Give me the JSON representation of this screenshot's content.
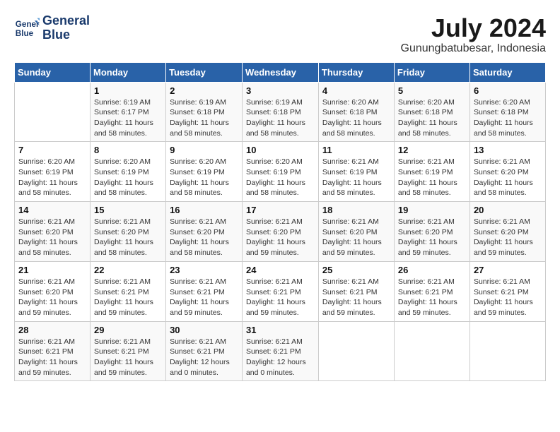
{
  "header": {
    "logo_line1": "General",
    "logo_line2": "Blue",
    "month_year": "July 2024",
    "location": "Gunungbatubesar, Indonesia"
  },
  "weekdays": [
    "Sunday",
    "Monday",
    "Tuesday",
    "Wednesday",
    "Thursday",
    "Friday",
    "Saturday"
  ],
  "weeks": [
    [
      {
        "num": "",
        "detail": ""
      },
      {
        "num": "1",
        "detail": "Sunrise: 6:19 AM\nSunset: 6:17 PM\nDaylight: 11 hours\nand 58 minutes."
      },
      {
        "num": "2",
        "detail": "Sunrise: 6:19 AM\nSunset: 6:18 PM\nDaylight: 11 hours\nand 58 minutes."
      },
      {
        "num": "3",
        "detail": "Sunrise: 6:19 AM\nSunset: 6:18 PM\nDaylight: 11 hours\nand 58 minutes."
      },
      {
        "num": "4",
        "detail": "Sunrise: 6:20 AM\nSunset: 6:18 PM\nDaylight: 11 hours\nand 58 minutes."
      },
      {
        "num": "5",
        "detail": "Sunrise: 6:20 AM\nSunset: 6:18 PM\nDaylight: 11 hours\nand 58 minutes."
      },
      {
        "num": "6",
        "detail": "Sunrise: 6:20 AM\nSunset: 6:18 PM\nDaylight: 11 hours\nand 58 minutes."
      }
    ],
    [
      {
        "num": "7",
        "detail": "Sunrise: 6:20 AM\nSunset: 6:19 PM\nDaylight: 11 hours\nand 58 minutes."
      },
      {
        "num": "8",
        "detail": "Sunrise: 6:20 AM\nSunset: 6:19 PM\nDaylight: 11 hours\nand 58 minutes."
      },
      {
        "num": "9",
        "detail": "Sunrise: 6:20 AM\nSunset: 6:19 PM\nDaylight: 11 hours\nand 58 minutes."
      },
      {
        "num": "10",
        "detail": "Sunrise: 6:20 AM\nSunset: 6:19 PM\nDaylight: 11 hours\nand 58 minutes."
      },
      {
        "num": "11",
        "detail": "Sunrise: 6:21 AM\nSunset: 6:19 PM\nDaylight: 11 hours\nand 58 minutes."
      },
      {
        "num": "12",
        "detail": "Sunrise: 6:21 AM\nSunset: 6:19 PM\nDaylight: 11 hours\nand 58 minutes."
      },
      {
        "num": "13",
        "detail": "Sunrise: 6:21 AM\nSunset: 6:20 PM\nDaylight: 11 hours\nand 58 minutes."
      }
    ],
    [
      {
        "num": "14",
        "detail": "Sunrise: 6:21 AM\nSunset: 6:20 PM\nDaylight: 11 hours\nand 58 minutes."
      },
      {
        "num": "15",
        "detail": "Sunrise: 6:21 AM\nSunset: 6:20 PM\nDaylight: 11 hours\nand 58 minutes."
      },
      {
        "num": "16",
        "detail": "Sunrise: 6:21 AM\nSunset: 6:20 PM\nDaylight: 11 hours\nand 58 minutes."
      },
      {
        "num": "17",
        "detail": "Sunrise: 6:21 AM\nSunset: 6:20 PM\nDaylight: 11 hours\nand 59 minutes."
      },
      {
        "num": "18",
        "detail": "Sunrise: 6:21 AM\nSunset: 6:20 PM\nDaylight: 11 hours\nand 59 minutes."
      },
      {
        "num": "19",
        "detail": "Sunrise: 6:21 AM\nSunset: 6:20 PM\nDaylight: 11 hours\nand 59 minutes."
      },
      {
        "num": "20",
        "detail": "Sunrise: 6:21 AM\nSunset: 6:20 PM\nDaylight: 11 hours\nand 59 minutes."
      }
    ],
    [
      {
        "num": "21",
        "detail": "Sunrise: 6:21 AM\nSunset: 6:20 PM\nDaylight: 11 hours\nand 59 minutes."
      },
      {
        "num": "22",
        "detail": "Sunrise: 6:21 AM\nSunset: 6:21 PM\nDaylight: 11 hours\nand 59 minutes."
      },
      {
        "num": "23",
        "detail": "Sunrise: 6:21 AM\nSunset: 6:21 PM\nDaylight: 11 hours\nand 59 minutes."
      },
      {
        "num": "24",
        "detail": "Sunrise: 6:21 AM\nSunset: 6:21 PM\nDaylight: 11 hours\nand 59 minutes."
      },
      {
        "num": "25",
        "detail": "Sunrise: 6:21 AM\nSunset: 6:21 PM\nDaylight: 11 hours\nand 59 minutes."
      },
      {
        "num": "26",
        "detail": "Sunrise: 6:21 AM\nSunset: 6:21 PM\nDaylight: 11 hours\nand 59 minutes."
      },
      {
        "num": "27",
        "detail": "Sunrise: 6:21 AM\nSunset: 6:21 PM\nDaylight: 11 hours\nand 59 minutes."
      }
    ],
    [
      {
        "num": "28",
        "detail": "Sunrise: 6:21 AM\nSunset: 6:21 PM\nDaylight: 11 hours\nand 59 minutes."
      },
      {
        "num": "29",
        "detail": "Sunrise: 6:21 AM\nSunset: 6:21 PM\nDaylight: 11 hours\nand 59 minutes."
      },
      {
        "num": "30",
        "detail": "Sunrise: 6:21 AM\nSunset: 6:21 PM\nDaylight: 12 hours\nand 0 minutes."
      },
      {
        "num": "31",
        "detail": "Sunrise: 6:21 AM\nSunset: 6:21 PM\nDaylight: 12 hours\nand 0 minutes."
      },
      {
        "num": "",
        "detail": ""
      },
      {
        "num": "",
        "detail": ""
      },
      {
        "num": "",
        "detail": ""
      }
    ]
  ]
}
